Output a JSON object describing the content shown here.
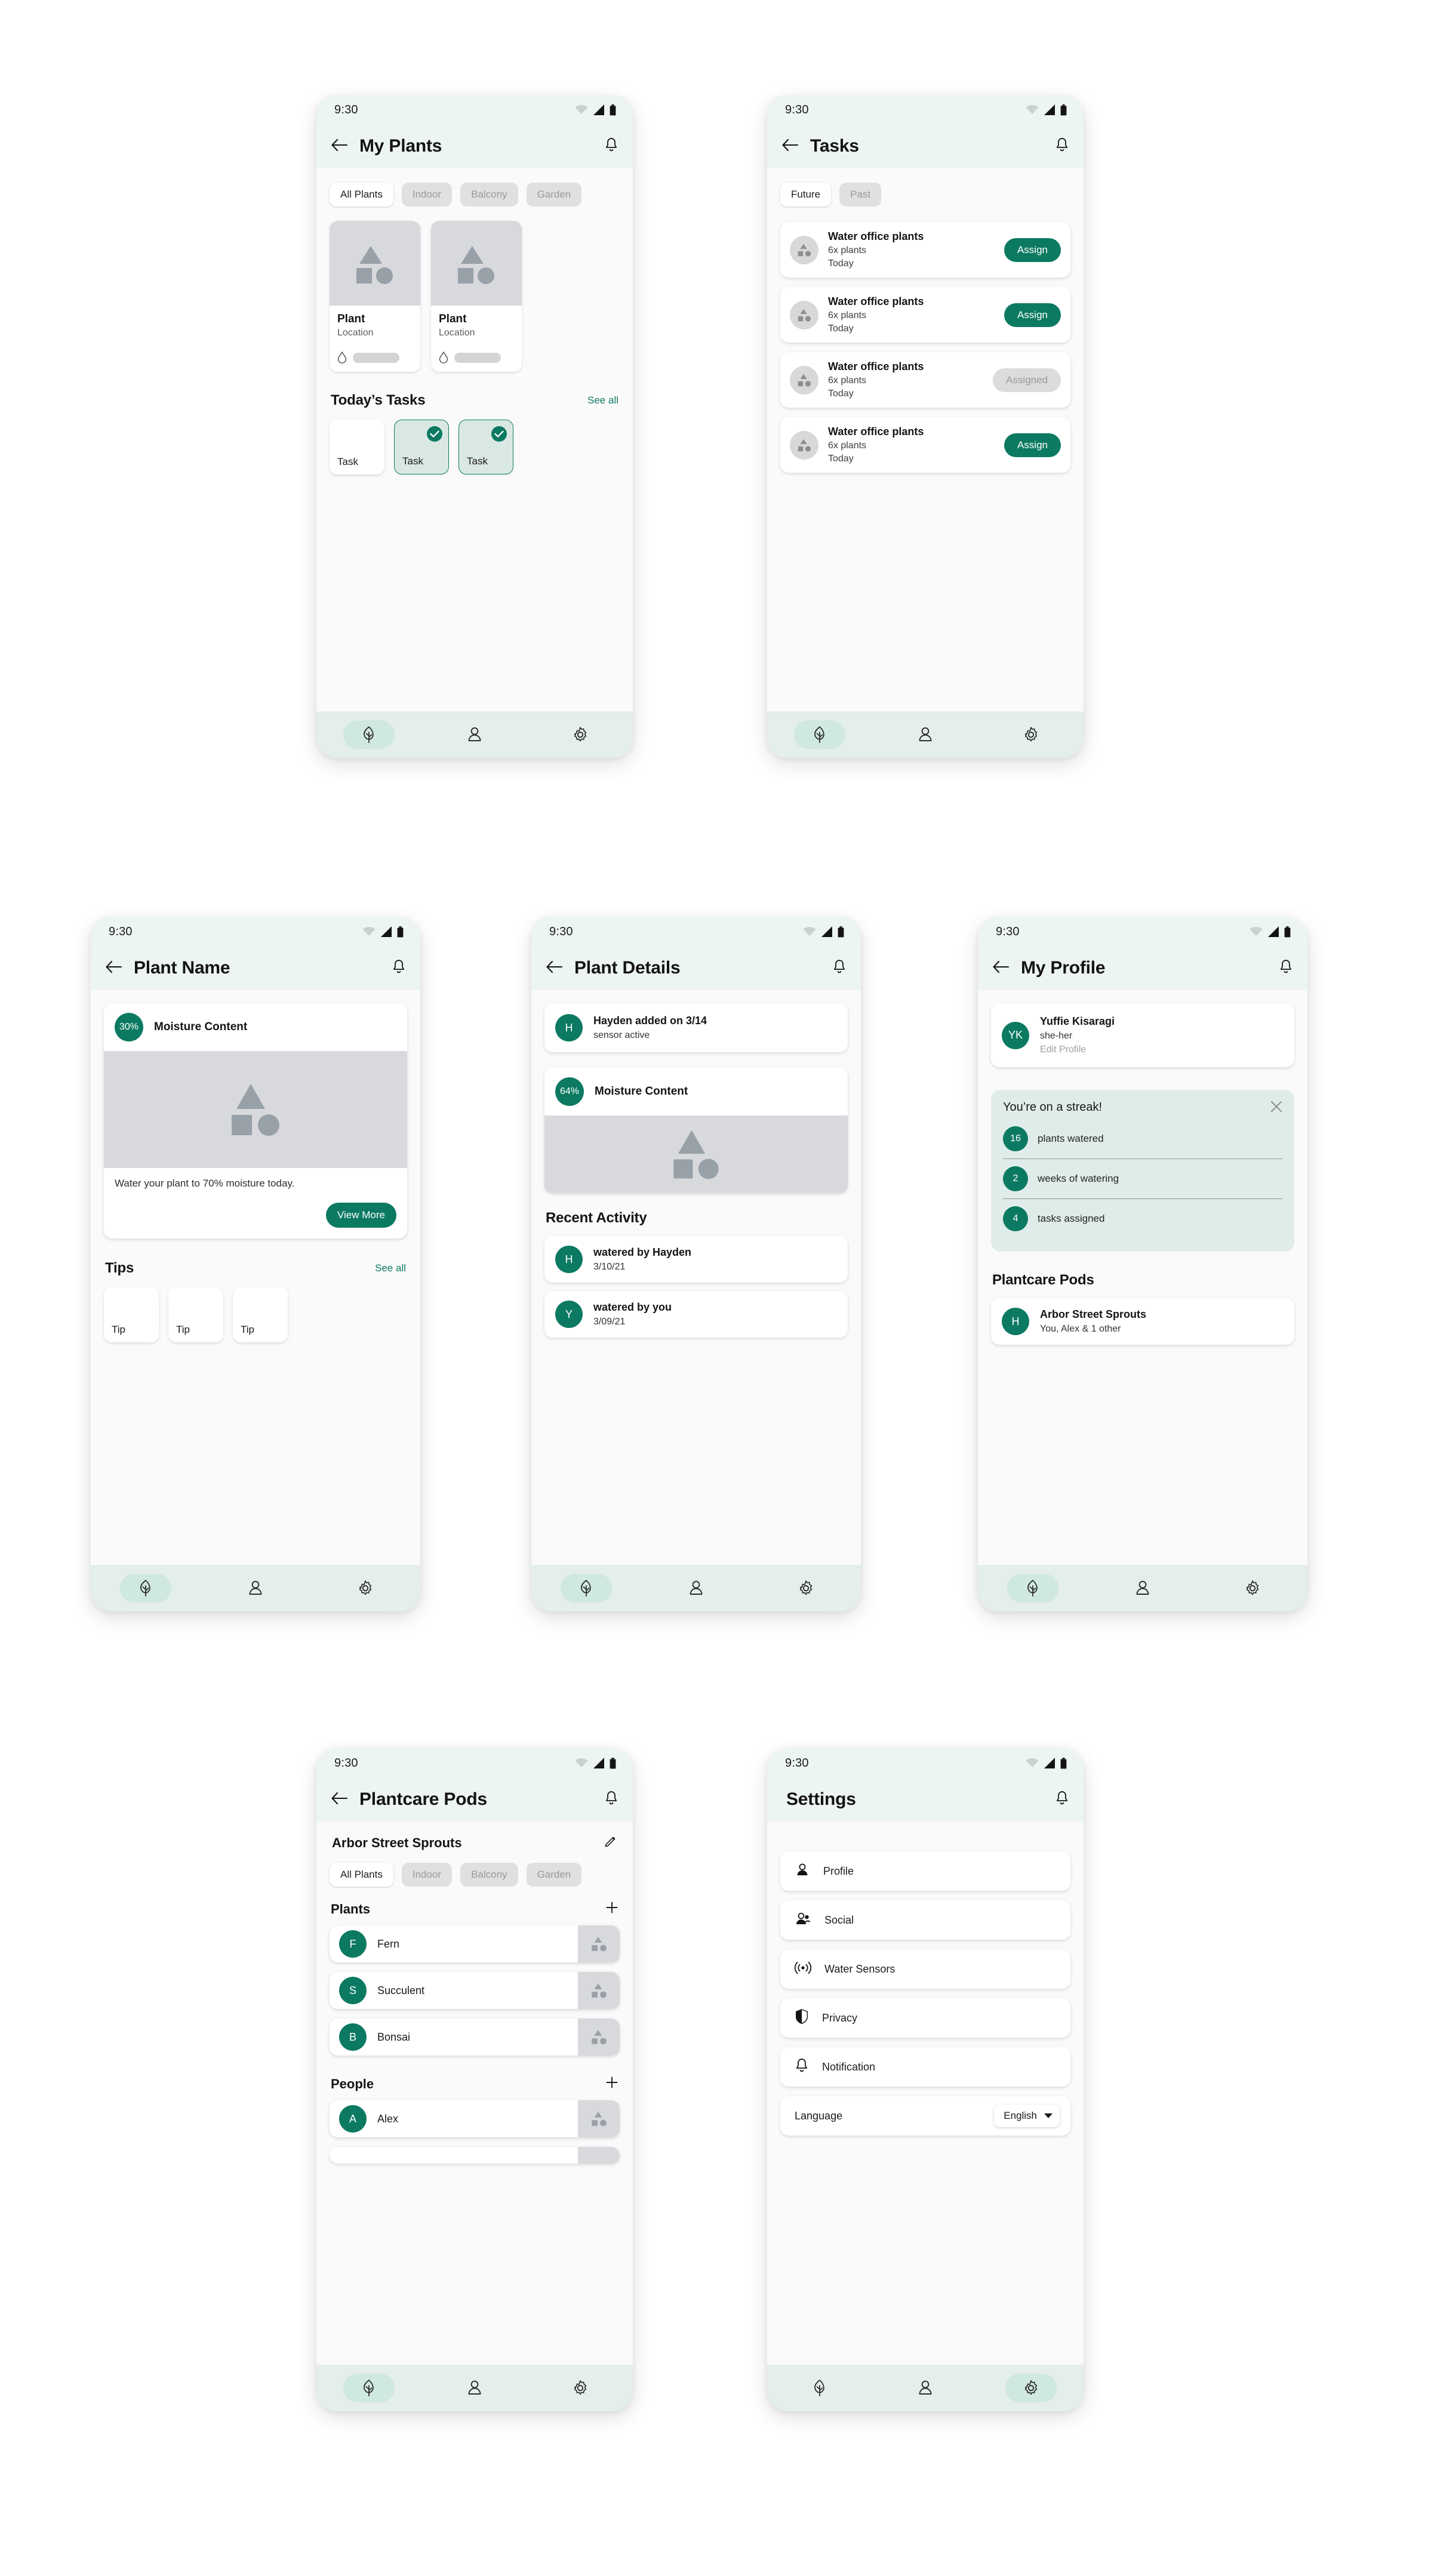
{
  "theme": {
    "accent": "#0c7a62",
    "appbar_bg": "#edf5f3",
    "navbar_bg": "#e4eeec",
    "body_bg": "#fafafa",
    "placeholder_gray": "#d7d9dd",
    "chip_inactive": "#e0e0e0",
    "streak_bg": "#e0ecea"
  },
  "status_bar": {
    "time": "9:30",
    "icons": [
      "wifi-icon",
      "cell-signal-icon",
      "battery-icon"
    ]
  },
  "nav": {
    "items": [
      {
        "name": "plants",
        "icon": "leaf-icon"
      },
      {
        "name": "profile",
        "icon": "person-icon"
      },
      {
        "name": "settings",
        "icon": "gear-icon"
      }
    ]
  },
  "screens": {
    "my_plants": {
      "title": "My Plants",
      "back_icon": "back-arrow-icon",
      "bell_icon": "bell-icon",
      "active_nav": 0,
      "chips": [
        "All Plants",
        "Indoor",
        "Balcony",
        "Garden"
      ],
      "active_chip": 0,
      "plants": [
        {
          "name": "Plant",
          "location": "Location"
        },
        {
          "name": "Plant",
          "location": "Location"
        }
      ],
      "tasks_section": {
        "heading": "Today’s Tasks",
        "see_all": "See all"
      },
      "task_tiles": [
        {
          "label": "Task",
          "done": false
        },
        {
          "label": "Task",
          "done": true
        },
        {
          "label": "Task",
          "done": true
        }
      ]
    },
    "tasks": {
      "title": "Tasks",
      "back_icon": "back-arrow-icon",
      "bell_icon": "bell-icon",
      "active_nav": 0,
      "chips": [
        "Future",
        "Past"
      ],
      "active_chip": 0,
      "items": [
        {
          "title": "Water office plants",
          "count": "6x plants",
          "when": "Today",
          "action": "Assign",
          "assigned": false
        },
        {
          "title": "Water office plants",
          "count": "6x plants",
          "when": "Today",
          "action": "Assign",
          "assigned": false
        },
        {
          "title": "Water office plants",
          "count": "6x plants",
          "when": "Today",
          "action": "Assigned",
          "assigned": true
        },
        {
          "title": "Water office plants",
          "count": "6x plants",
          "when": "Today",
          "action": "Assign",
          "assigned": false
        }
      ]
    },
    "plant_name": {
      "title": "Plant Name",
      "back_icon": "back-arrow-icon",
      "bell_icon": "bell-icon",
      "active_nav": 0,
      "moisture": {
        "percent": "30%",
        "label": "Moisture Content",
        "note": "Water your plant to 70% moisture today.",
        "button": "View More"
      },
      "tips_section": {
        "heading": "Tips",
        "see_all": "See all"
      },
      "tips": [
        "Tip",
        "Tip",
        "Tip"
      ]
    },
    "plant_details": {
      "title": "Plant Details",
      "back_icon": "back-arrow-icon",
      "bell_icon": "bell-icon",
      "active_nav": 0,
      "added": {
        "initial": "H",
        "title": "Hayden added on 3/14",
        "subtitle": "sensor active"
      },
      "moisture": {
        "percent": "64%",
        "label": "Moisture Content"
      },
      "activity_heading": "Recent Activity",
      "activity": [
        {
          "initial": "H",
          "title": "watered by Hayden",
          "date": "3/10/21"
        },
        {
          "initial": "Y",
          "title": "watered by you",
          "date": "3/09/21"
        }
      ]
    },
    "my_profile": {
      "title": "My Profile",
      "back_icon": "back-arrow-icon",
      "bell_icon": "bell-icon",
      "active_nav": 0,
      "user": {
        "initials": "YK",
        "name": "Yuffie Kisaragi",
        "pronouns": "she-her",
        "edit": "Edit Profile"
      },
      "streak": {
        "heading": "You’re on a streak!",
        "close_icon": "close-icon",
        "rows": [
          {
            "value": "16",
            "label": "plants watered"
          },
          {
            "value": "2",
            "label": "weeks of watering"
          },
          {
            "value": "4",
            "label": "tasks assigned"
          }
        ]
      },
      "pods_heading": "Plantcare Pods",
      "pods": [
        {
          "initial": "H",
          "name": "Arbor Street Sprouts",
          "members": "You, Alex & 1 other"
        }
      ]
    },
    "plantcare_pods": {
      "title": "Plantcare Pods",
      "back_icon": "back-arrow-icon",
      "bell_icon": "bell-icon",
      "active_nav": 0,
      "pod_name": "Arbor Street Sprouts",
      "edit_icon": "pencil-icon",
      "chips": [
        "All Plants",
        "Indoor",
        "Balcony",
        "Garden"
      ],
      "active_chip": 0,
      "plants_heading": "Plants",
      "add_icon": "plus-icon",
      "plants": [
        {
          "initial": "F",
          "name": "Fern"
        },
        {
          "initial": "S",
          "name": "Succulent"
        },
        {
          "initial": "B",
          "name": "Bonsai"
        }
      ],
      "people_heading": "People",
      "people": [
        {
          "initial": "A",
          "name": "Alex"
        }
      ]
    },
    "settings": {
      "title": "Settings",
      "bell_icon": "bell-icon",
      "active_nav": 2,
      "rows": [
        {
          "label": "Profile",
          "icon": "person-icon"
        },
        {
          "label": "Social",
          "icon": "people-icon"
        },
        {
          "label": "Water Sensors",
          "icon": "sensor-waves-icon"
        },
        {
          "label": "Privacy",
          "icon": "shield-icon"
        },
        {
          "label": "Notification",
          "icon": "bell-icon"
        }
      ],
      "language": {
        "label": "Language",
        "value": "English",
        "caret_icon": "chevron-down-icon"
      }
    }
  }
}
